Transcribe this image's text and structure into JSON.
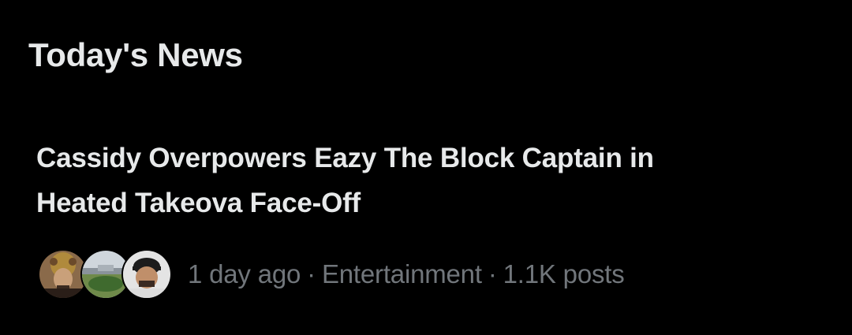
{
  "section": {
    "title": "Today's News"
  },
  "news_item": {
    "headline_line1": "Cassidy Overpowers Eazy The Block Captain in",
    "headline_line2": "Heated Takeova Face-Off",
    "time": "1 day ago",
    "separator": "·",
    "category": "Entertainment",
    "posts": "1.1K posts"
  },
  "avatars": [
    {
      "name": "avatar-1"
    },
    {
      "name": "avatar-2"
    },
    {
      "name": "avatar-3"
    }
  ],
  "colors": {
    "background": "#000000",
    "primary_text": "#e7e9ea",
    "secondary_text": "#71767b"
  }
}
